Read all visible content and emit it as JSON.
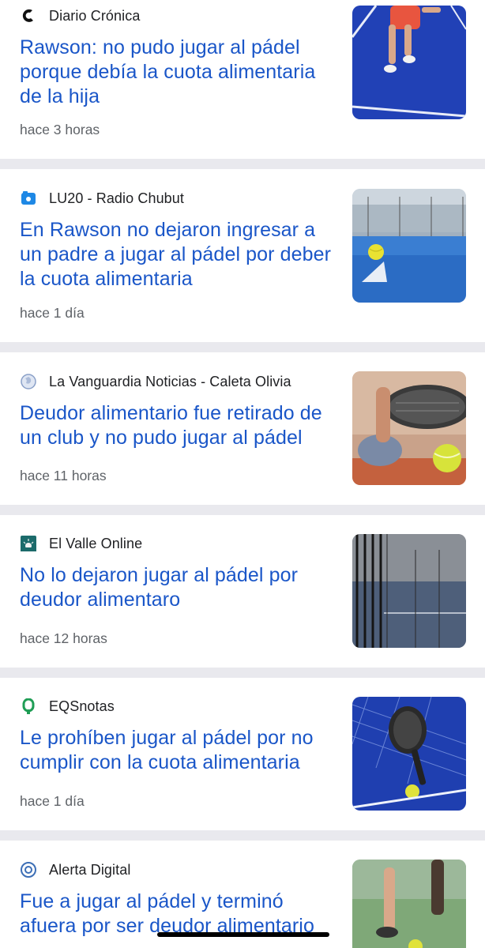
{
  "articles": [
    {
      "source": "Diario Crónica",
      "source_icon": "cronica-logo-icon",
      "headline": "Rawson: no pudo jugar al pádel porque debía la cuota alimentaria de la hija",
      "time": "hace 3 horas",
      "thumbnail": "padel-player-blue-court-image"
    },
    {
      "source": "LU20 - Radio Chubut",
      "source_icon": "radio-chubut-logo-icon",
      "headline": "En Rawson no dejaron ingresar a un padre a jugar al pádel por deber la cuota alimentaria",
      "time": "hace 1 día",
      "thumbnail": "padel-ball-court-net-image"
    },
    {
      "source": "La Vanguardia Noticias - Caleta Olivia",
      "source_icon": "globe-icon",
      "headline": "Deudor alimentario fue retirado de un club y no pudo jugar al pádel",
      "time": "hace 11 horas",
      "thumbnail": "padel-racket-shoe-ball-image"
    },
    {
      "source": "El Valle Online",
      "source_icon": "el-valle-logo-icon",
      "headline": "No lo dejaron jugar al pádel por deudor alimentaro",
      "time": "hace 12 horas",
      "thumbnail": "padel-court-fence-image"
    },
    {
      "source": "EQSnotas",
      "source_icon": "eqsnotas-logo-icon",
      "headline": "Le prohíben jugar al pádel por no cumplir con la cuota alimentaria",
      "time": "hace 1 día",
      "thumbnail": "padel-racket-net-ball-image"
    },
    {
      "source": "Alerta Digital",
      "source_icon": "alerta-digital-logo-icon",
      "headline": "Fue a jugar al pádel y terminó afuera por ser deudor alimentario",
      "time": "",
      "thumbnail": "padel-players-feet-ball-image"
    }
  ],
  "colors": {
    "headline": "#1a56c8",
    "source": "#202124",
    "time": "#5f6368",
    "separator": "#e9e9ee"
  }
}
